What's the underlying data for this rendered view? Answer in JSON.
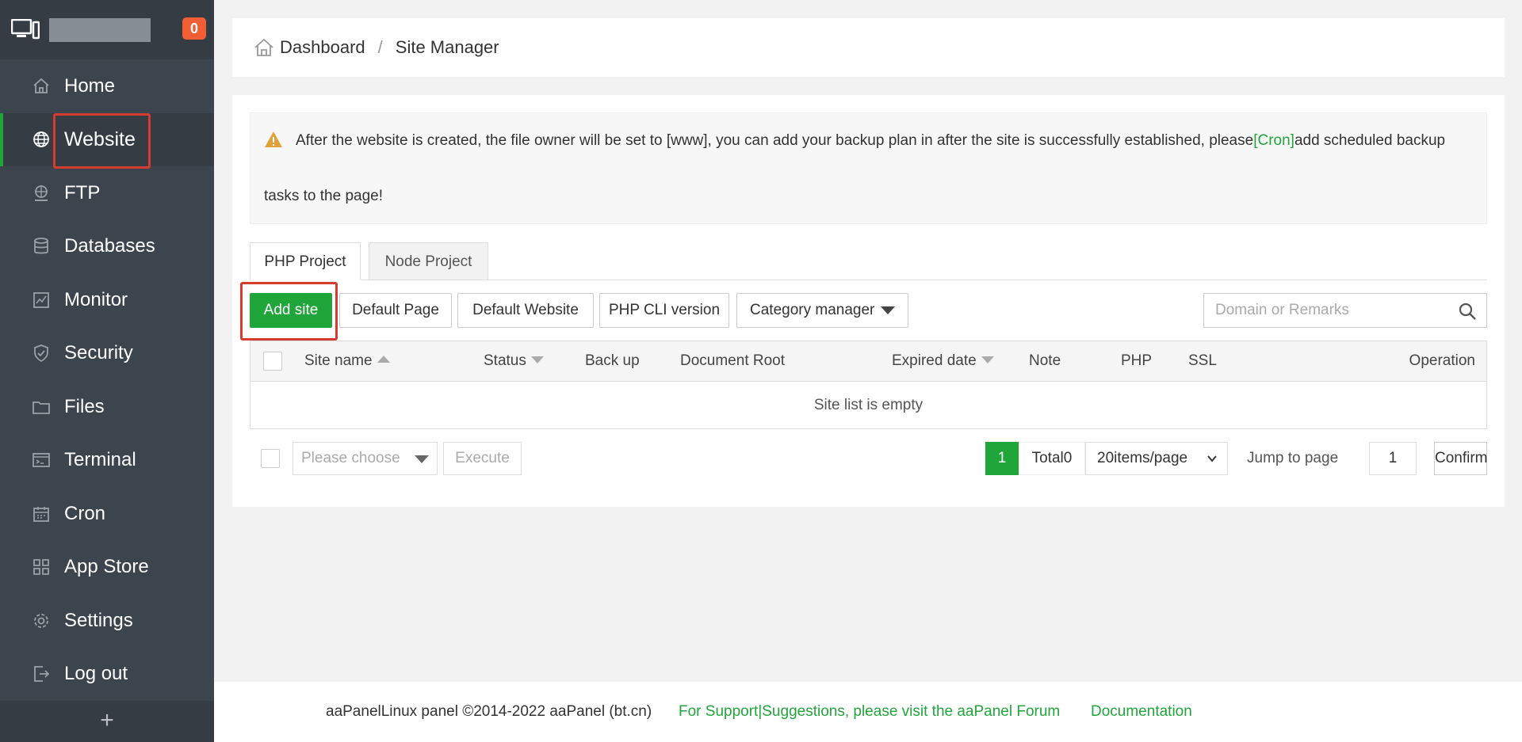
{
  "sidebar": {
    "badge": "0",
    "items": [
      {
        "label": "Home",
        "icon": "home-icon"
      },
      {
        "label": "Website",
        "icon": "globe-icon",
        "active": true
      },
      {
        "label": "FTP",
        "icon": "ftp-icon"
      },
      {
        "label": "Databases",
        "icon": "database-icon"
      },
      {
        "label": "Monitor",
        "icon": "monitor-icon"
      },
      {
        "label": "Security",
        "icon": "shield-icon"
      },
      {
        "label": "Files",
        "icon": "folder-icon"
      },
      {
        "label": "Terminal",
        "icon": "terminal-icon"
      },
      {
        "label": "Cron",
        "icon": "calendar-icon"
      },
      {
        "label": "App Store",
        "icon": "grid-icon"
      },
      {
        "label": "Settings",
        "icon": "gear-icon"
      },
      {
        "label": "Log out",
        "icon": "logout-icon"
      }
    ],
    "add_label": "+"
  },
  "breadcrumb": {
    "home": "Dashboard",
    "separator": "/",
    "current": "Site Manager"
  },
  "alert": {
    "text_before": "After the website is created, the file owner will be set to [www], you can add your backup plan in after the site is successfully established, please",
    "link": "[Cron]",
    "text_after": "add scheduled backup",
    "text_line2": "tasks to the page!"
  },
  "tabs": [
    {
      "label": "PHP Project",
      "active": true
    },
    {
      "label": "Node Project",
      "active": false
    }
  ],
  "toolbar": {
    "add_site": "Add site",
    "default_page": "Default Page",
    "default_website": "Default Website",
    "php_cli": "PHP CLI version",
    "category_manager": "Category manager",
    "search_placeholder": "Domain or Remarks"
  },
  "table": {
    "columns": [
      "Site name",
      "Status",
      "Back up",
      "Document Root",
      "Expired date",
      "Note",
      "PHP",
      "SSL",
      "Operation"
    ],
    "empty_text": "Site list is empty"
  },
  "bottom_bar": {
    "batch_placeholder": "Please choose",
    "execute": "Execute",
    "current_page": "1",
    "total": "Total0",
    "per_page": "20items/page",
    "jump_label": "Jump to page",
    "jump_value": "1",
    "confirm": "Confirm"
  },
  "footer": {
    "copyright": "aaPanelLinux panel ©2014-2022 aaPanel (bt.cn)",
    "support": "For Support|Suggestions, please visit the aaPanel Forum",
    "docs": "Documentation"
  },
  "colors": {
    "accent": "#20a53a",
    "sidebar_bg": "#3c444d",
    "badge": "#f25e33",
    "highlight": "#d63b2f"
  }
}
